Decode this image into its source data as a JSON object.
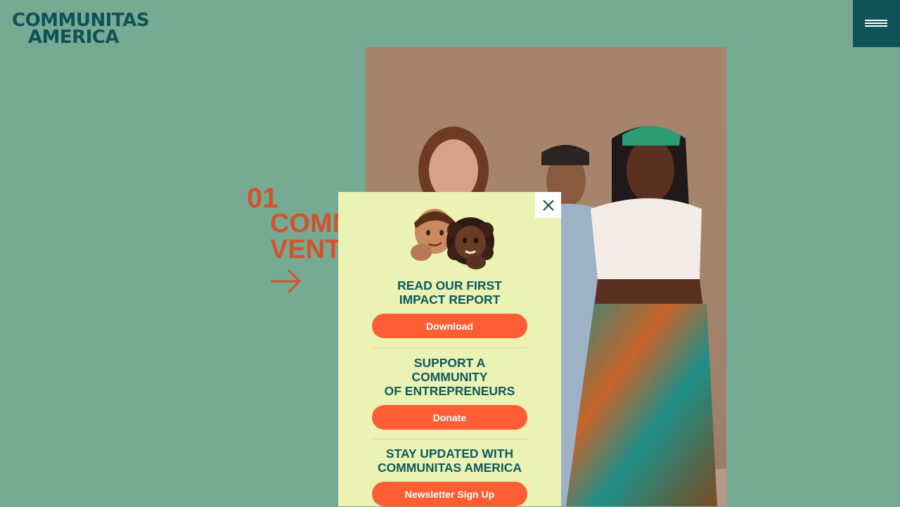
{
  "logo": {
    "line1": "COMMUNITAS",
    "line2": "AMERICA"
  },
  "slide": {
    "number": "01",
    "title_line1": "COMM",
    "title_line2": "VENTU"
  },
  "popup": {
    "report": {
      "heading_line1": "READ OUR FIRST",
      "heading_line2": "IMPACT REPORT",
      "button": "Download"
    },
    "support": {
      "heading_line1": "SUPPORT A",
      "heading_line2": "COMMUNITY",
      "heading_line3": "OF ENTREPRENEURS",
      "button": "Donate"
    },
    "updates": {
      "heading_line1": "STAY UPDATED WITH",
      "heading_line2": "COMMUNITAS AMERICA",
      "button": "Newsletter Sign Up"
    }
  },
  "colors": {
    "background": "#76aa92",
    "brand_teal": "#0f5257",
    "accent_orange": "#fd5e33",
    "slide_text": "#d2532e",
    "popup_bg": "#eaf2b4"
  },
  "icons": [
    "menu-icon",
    "close-icon",
    "arrow-right-icon",
    "emoji-icon"
  ]
}
